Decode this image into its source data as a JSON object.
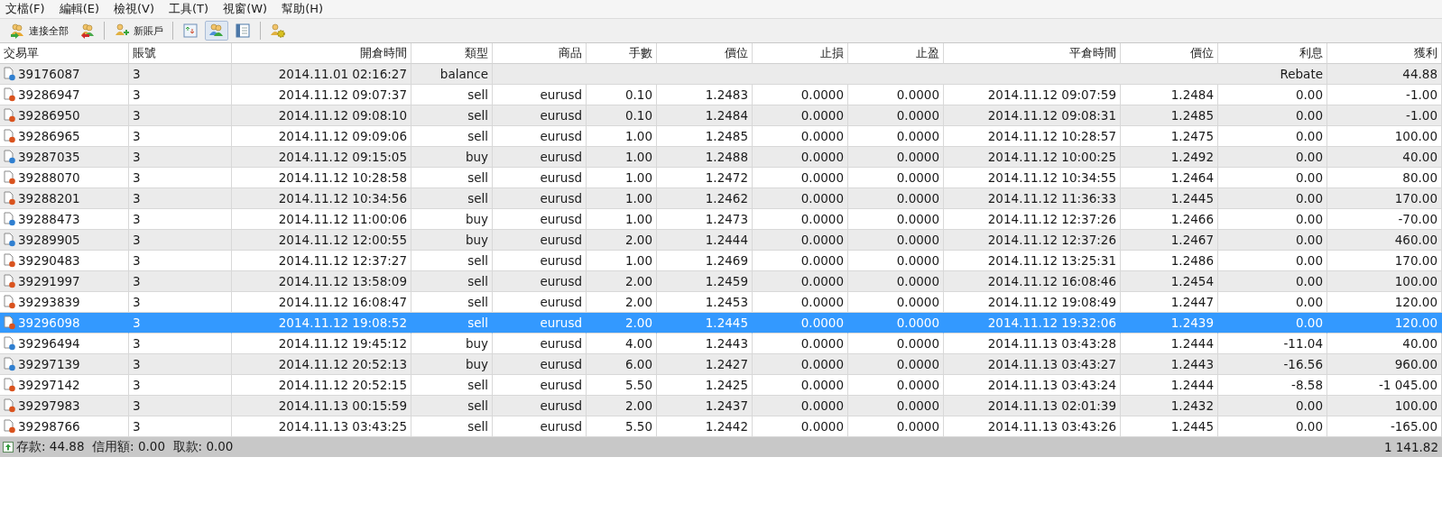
{
  "menu": [
    "文檔(F)",
    "編輯(E)",
    "檢視(V)",
    "工具(T)",
    "視窗(W)",
    "幫助(H)"
  ],
  "toolbar": [
    {
      "kind": "labeled",
      "label": "連接全部",
      "pressed": false
    },
    {
      "kind": "icon",
      "pressed": false
    },
    {
      "kind": "separator"
    },
    {
      "kind": "labeled",
      "label": "新賬戶",
      "pressed": false
    },
    {
      "kind": "separator"
    },
    {
      "kind": "icon",
      "pressed": false
    },
    {
      "kind": "icon",
      "pressed": true
    },
    {
      "kind": "icon",
      "pressed": false
    },
    {
      "kind": "separator"
    },
    {
      "kind": "icon",
      "pressed": false
    }
  ],
  "table": {
    "columns": [
      "交易單",
      "賬號",
      "開倉時間",
      "類型",
      "商品",
      "手數",
      "價位",
      "止損",
      "止盈",
      "平倉時間",
      "價位",
      "利息",
      "獲利"
    ],
    "rows": [
      {
        "kind": "balance",
        "color": "#2f7fd0",
        "selected": false,
        "ticket": "39176087",
        "account": "3",
        "open_time": "2014.11.01 02:16:27",
        "type": "balance",
        "comment": "Rebate",
        "profit": "44.88"
      },
      {
        "kind": "trade",
        "color": "#d9531e",
        "selected": false,
        "ticket": "39286947",
        "account": "3",
        "open_time": "2014.11.12 09:07:37",
        "type": "sell",
        "symbol": "eurusd",
        "lots": "0.10",
        "open_price": "1.2483",
        "sl": "0.0000",
        "tp": "0.0000",
        "close_time": "2014.11.12 09:07:59",
        "close_price": "1.2484",
        "swap": "0.00",
        "profit": "-1.00"
      },
      {
        "kind": "trade",
        "color": "#d9531e",
        "selected": false,
        "ticket": "39286950",
        "account": "3",
        "open_time": "2014.11.12 09:08:10",
        "type": "sell",
        "symbol": "eurusd",
        "lots": "0.10",
        "open_price": "1.2484",
        "sl": "0.0000",
        "tp": "0.0000",
        "close_time": "2014.11.12 09:08:31",
        "close_price": "1.2485",
        "swap": "0.00",
        "profit": "-1.00"
      },
      {
        "kind": "trade",
        "color": "#d9531e",
        "selected": false,
        "ticket": "39286965",
        "account": "3",
        "open_time": "2014.11.12 09:09:06",
        "type": "sell",
        "symbol": "eurusd",
        "lots": "1.00",
        "open_price": "1.2485",
        "sl": "0.0000",
        "tp": "0.0000",
        "close_time": "2014.11.12 10:28:57",
        "close_price": "1.2475",
        "swap": "0.00",
        "profit": "100.00"
      },
      {
        "kind": "trade",
        "color": "#2f7fd0",
        "selected": false,
        "ticket": "39287035",
        "account": "3",
        "open_time": "2014.11.12 09:15:05",
        "type": "buy",
        "symbol": "eurusd",
        "lots": "1.00",
        "open_price": "1.2488",
        "sl": "0.0000",
        "tp": "0.0000",
        "close_time": "2014.11.12 10:00:25",
        "close_price": "1.2492",
        "swap": "0.00",
        "profit": "40.00"
      },
      {
        "kind": "trade",
        "color": "#d9531e",
        "selected": false,
        "ticket": "39288070",
        "account": "3",
        "open_time": "2014.11.12 10:28:58",
        "type": "sell",
        "symbol": "eurusd",
        "lots": "1.00",
        "open_price": "1.2472",
        "sl": "0.0000",
        "tp": "0.0000",
        "close_time": "2014.11.12 10:34:55",
        "close_price": "1.2464",
        "swap": "0.00",
        "profit": "80.00"
      },
      {
        "kind": "trade",
        "color": "#d9531e",
        "selected": false,
        "ticket": "39288201",
        "account": "3",
        "open_time": "2014.11.12 10:34:56",
        "type": "sell",
        "symbol": "eurusd",
        "lots": "1.00",
        "open_price": "1.2462",
        "sl": "0.0000",
        "tp": "0.0000",
        "close_time": "2014.11.12 11:36:33",
        "close_price": "1.2445",
        "swap": "0.00",
        "profit": "170.00"
      },
      {
        "kind": "trade",
        "color": "#2f7fd0",
        "selected": false,
        "ticket": "39288473",
        "account": "3",
        "open_time": "2014.11.12 11:00:06",
        "type": "buy",
        "symbol": "eurusd",
        "lots": "1.00",
        "open_price": "1.2473",
        "sl": "0.0000",
        "tp": "0.0000",
        "close_time": "2014.11.12 12:37:26",
        "close_price": "1.2466",
        "swap": "0.00",
        "profit": "-70.00"
      },
      {
        "kind": "trade",
        "color": "#2f7fd0",
        "selected": false,
        "ticket": "39289905",
        "account": "3",
        "open_time": "2014.11.12 12:00:55",
        "type": "buy",
        "symbol": "eurusd",
        "lots": "2.00",
        "open_price": "1.2444",
        "sl": "0.0000",
        "tp": "0.0000",
        "close_time": "2014.11.12 12:37:26",
        "close_price": "1.2467",
        "swap": "0.00",
        "profit": "460.00"
      },
      {
        "kind": "trade",
        "color": "#d9531e",
        "selected": false,
        "ticket": "39290483",
        "account": "3",
        "open_time": "2014.11.12 12:37:27",
        "type": "sell",
        "symbol": "eurusd",
        "lots": "1.00",
        "open_price": "1.2469",
        "sl": "0.0000",
        "tp": "0.0000",
        "close_time": "2014.11.12 13:25:31",
        "close_price": "1.2486",
        "swap": "0.00",
        "profit": "170.00"
      },
      {
        "kind": "trade",
        "color": "#d9531e",
        "selected": false,
        "ticket": "39291997",
        "account": "3",
        "open_time": "2014.11.12 13:58:09",
        "type": "sell",
        "symbol": "eurusd",
        "lots": "2.00",
        "open_price": "1.2459",
        "sl": "0.0000",
        "tp": "0.0000",
        "close_time": "2014.11.12 16:08:46",
        "close_price": "1.2454",
        "swap": "0.00",
        "profit": "100.00"
      },
      {
        "kind": "trade",
        "color": "#d9531e",
        "selected": false,
        "ticket": "39293839",
        "account": "3",
        "open_time": "2014.11.12 16:08:47",
        "type": "sell",
        "symbol": "eurusd",
        "lots": "2.00",
        "open_price": "1.2453",
        "sl": "0.0000",
        "tp": "0.0000",
        "close_time": "2014.11.12 19:08:49",
        "close_price": "1.2447",
        "swap": "0.00",
        "profit": "120.00"
      },
      {
        "kind": "trade",
        "color": "#d9531e",
        "selected": true,
        "ticket": "39296098",
        "account": "3",
        "open_time": "2014.11.12 19:08:52",
        "type": "sell",
        "symbol": "eurusd",
        "lots": "2.00",
        "open_price": "1.2445",
        "sl": "0.0000",
        "tp": "0.0000",
        "close_time": "2014.11.12 19:32:06",
        "close_price": "1.2439",
        "swap": "0.00",
        "profit": "120.00"
      },
      {
        "kind": "trade",
        "color": "#2f7fd0",
        "selected": false,
        "ticket": "39296494",
        "account": "3",
        "open_time": "2014.11.12 19:45:12",
        "type": "buy",
        "symbol": "eurusd",
        "lots": "4.00",
        "open_price": "1.2443",
        "sl": "0.0000",
        "tp": "0.0000",
        "close_time": "2014.11.13 03:43:28",
        "close_price": "1.2444",
        "swap": "-11.04",
        "profit": "40.00"
      },
      {
        "kind": "trade",
        "color": "#2f7fd0",
        "selected": false,
        "ticket": "39297139",
        "account": "3",
        "open_time": "2014.11.12 20:52:13",
        "type": "buy",
        "symbol": "eurusd",
        "lots": "6.00",
        "open_price": "1.2427",
        "sl": "0.0000",
        "tp": "0.0000",
        "close_time": "2014.11.13 03:43:27",
        "close_price": "1.2443",
        "swap": "-16.56",
        "profit": "960.00"
      },
      {
        "kind": "trade",
        "color": "#d9531e",
        "selected": false,
        "ticket": "39297142",
        "account": "3",
        "open_time": "2014.11.12 20:52:15",
        "type": "sell",
        "symbol": "eurusd",
        "lots": "5.50",
        "open_price": "1.2425",
        "sl": "0.0000",
        "tp": "0.0000",
        "close_time": "2014.11.13 03:43:24",
        "close_price": "1.2444",
        "swap": "-8.58",
        "profit": "-1 045.00"
      },
      {
        "kind": "trade",
        "color": "#d9531e",
        "selected": false,
        "ticket": "39297983",
        "account": "3",
        "open_time": "2014.11.13 00:15:59",
        "type": "sell",
        "symbol": "eurusd",
        "lots": "2.00",
        "open_price": "1.2437",
        "sl": "0.0000",
        "tp": "0.0000",
        "close_time": "2014.11.13 02:01:39",
        "close_price": "1.2432",
        "swap": "0.00",
        "profit": "100.00"
      },
      {
        "kind": "trade",
        "color": "#d9531e",
        "selected": false,
        "ticket": "39298766",
        "account": "3",
        "open_time": "2014.11.13 03:43:25",
        "type": "sell",
        "symbol": "eurusd",
        "lots": "5.50",
        "open_price": "1.2442",
        "sl": "0.0000",
        "tp": "0.0000",
        "close_time": "2014.11.13 03:43:26",
        "close_price": "1.2445",
        "swap": "0.00",
        "profit": "-165.00"
      }
    ]
  },
  "summary": {
    "text": "存款: 44.88  信用額: 0.00  取款: 0.00",
    "total": "1 141.82"
  }
}
